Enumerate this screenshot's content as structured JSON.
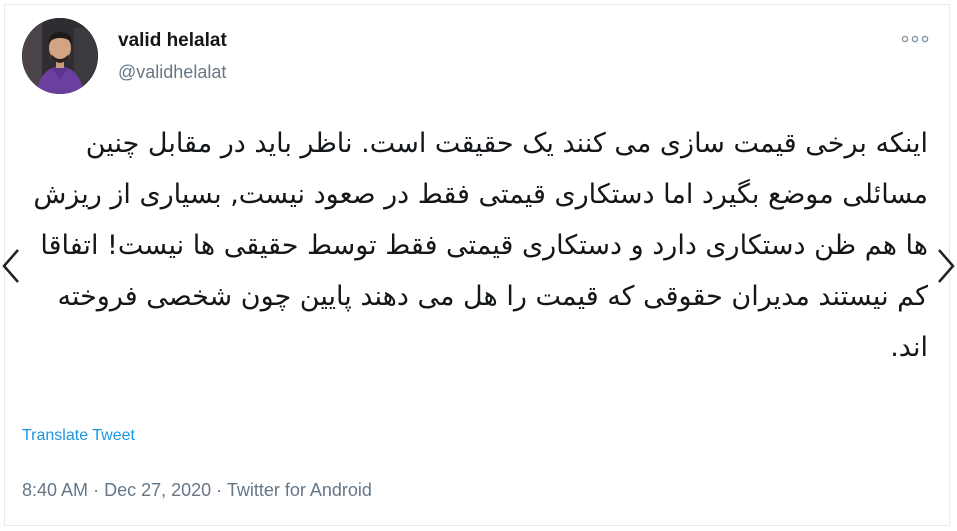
{
  "user": {
    "display_name": "valid helalat",
    "handle": "@validhelalat"
  },
  "tweet": {
    "text": "اینکه برخی قیمت سازی می کنند یک حقیقت است. ناظر باید در مقابل چنین مسائلی موضع بگیرد اما دستکاری قیمتی فقط در صعود نیست, بسیاری از ریزش ها هم ظن دستکاری دارد و دستکاری قیمتی فقط توسط حقیقی ها نیست! اتفاقا کم نیستند مدیران حقوقی که قیمت را هل می دهند پایین چون شخصی فروخته اند.",
    "translate_label": "Translate Tweet"
  },
  "meta": {
    "time": "8:40 AM",
    "separator": "·",
    "date": "Dec 27, 2020",
    "source": "Twitter for Android"
  },
  "icons": {
    "more": "more-dots-icon",
    "prev": "chevron-left-icon",
    "next": "chevron-right-icon"
  },
  "colors": {
    "link": "#1b95e0",
    "secondary_text": "#657786",
    "primary_text": "#14171a"
  }
}
